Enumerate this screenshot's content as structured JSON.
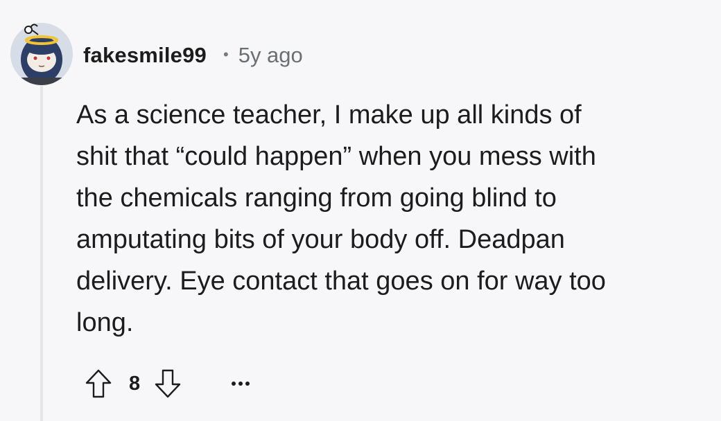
{
  "comment": {
    "author": "fakesmile99",
    "separator": "•",
    "timestamp": "5y ago",
    "body": "As a science teacher, I make up all kinds of\nshit that “could happen” when you mess with\nthe chemicals ranging from going blind to\namputating bits of your body off. Deadpan\ndelivery. Eye contact that goes on for way too\nlong.",
    "score": "8"
  },
  "icons": {
    "avatar": "user-avatar",
    "upvote": "arrow-up-icon",
    "downvote": "arrow-down-icon",
    "more": "more-options-icon"
  },
  "colors": {
    "background": "#f7f7f9",
    "text": "#1c1c1c",
    "meta": "#6b6f73",
    "thread_line": "#e4e6e8"
  }
}
